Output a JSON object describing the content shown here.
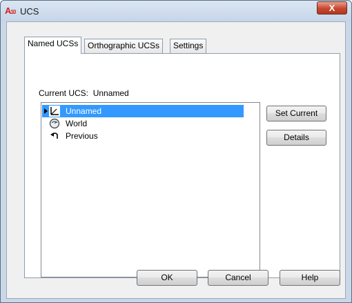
{
  "window": {
    "title": "UCS",
    "app_icon_text": "A",
    "app_icon_sub": "10",
    "close_glyph": "X"
  },
  "tabs": [
    {
      "label": "Named UCSs",
      "active": true
    },
    {
      "label": "Orthographic UCSs",
      "active": false
    },
    {
      "label": "Settings",
      "active": false
    }
  ],
  "current_ucs": {
    "label": "Current UCS:",
    "value": "Unnamed"
  },
  "ucs_list": [
    {
      "label": "Unnamed",
      "icon": "ucs-axis-icon",
      "selected": true,
      "current_marker": true
    },
    {
      "label": "World",
      "icon": "world-globe-icon",
      "selected": false
    },
    {
      "label": "Previous",
      "icon": "previous-arrow-icon",
      "selected": false
    }
  ],
  "side_buttons": {
    "set_current": "Set Current",
    "details": "Details"
  },
  "footer_buttons": {
    "ok": "OK",
    "cancel": "Cancel",
    "help": "Help"
  },
  "colors": {
    "selection": "#3399ff",
    "title_close": "#c8462e",
    "app_icon": "#d02020"
  }
}
